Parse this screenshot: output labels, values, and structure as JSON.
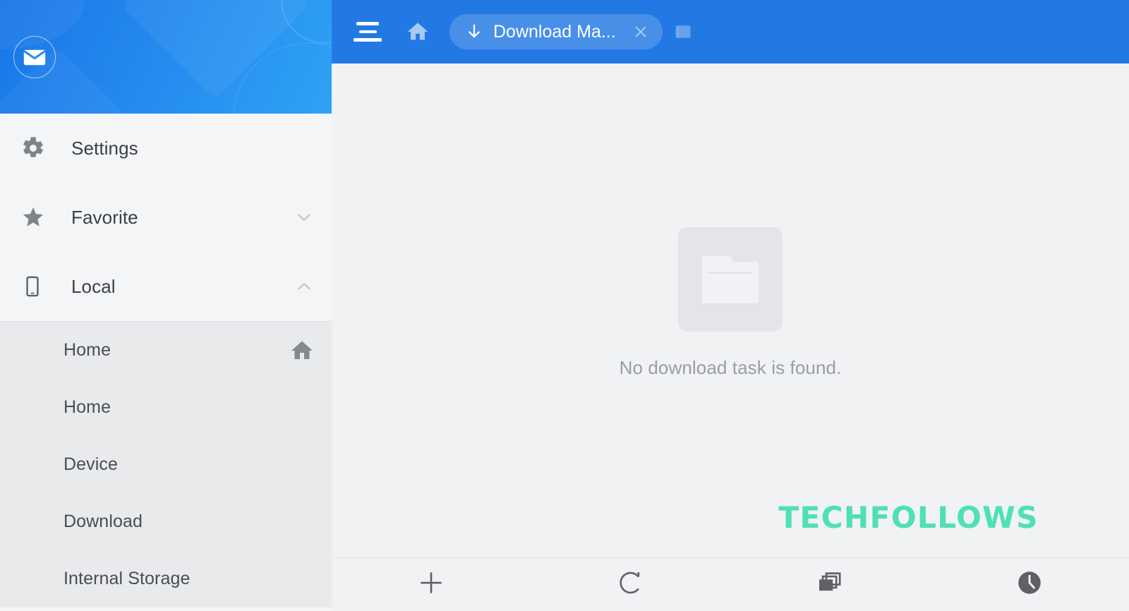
{
  "app": {
    "accent_blue": "#2379e4",
    "header_gradient_from": "#1976e8",
    "header_gradient_to": "#2fa2f4",
    "content_bg": "#f1f2f4",
    "sidebar_bg": "#f4f5f7",
    "submenu_bg": "#e9eaec",
    "watermark_color": "#4fe0b6"
  },
  "sidebar": {
    "avatar_icon": "envelope-icon",
    "items": [
      {
        "label": "Settings",
        "icon": "gear-icon",
        "chevron": ""
      },
      {
        "label": "Favorite",
        "icon": "star-icon",
        "chevron": "chevron-down-icon"
      },
      {
        "label": "Local",
        "icon": "phone-icon",
        "chevron": "chevron-up-icon"
      }
    ],
    "sub_items": [
      {
        "label": "Home",
        "icon": "home-icon"
      },
      {
        "label": "Home",
        "icon": ""
      },
      {
        "label": "Device",
        "icon": ""
      },
      {
        "label": "Download",
        "icon": ""
      },
      {
        "label": "Internal Storage",
        "icon": ""
      }
    ]
  },
  "toolbar": {
    "menu_icon": "hamburger-icon",
    "home_icon": "home-icon",
    "bookmark_icon": "bookmark-icon",
    "tab": {
      "icon": "download-arrow-icon",
      "title": "Download Ma...",
      "close_icon": "close-icon"
    }
  },
  "content": {
    "empty_icon": "empty-folder-icon",
    "empty_message": "No download task is found.",
    "watermark": "TECHFOLLOWS"
  },
  "bottombar": {
    "buttons": [
      {
        "name": "add-button",
        "icon": "plus-icon"
      },
      {
        "name": "refresh-button",
        "icon": "refresh-icon"
      },
      {
        "name": "tabs-button",
        "icon": "windows-stack-icon"
      },
      {
        "name": "history-button",
        "icon": "clock-icon"
      }
    ]
  }
}
